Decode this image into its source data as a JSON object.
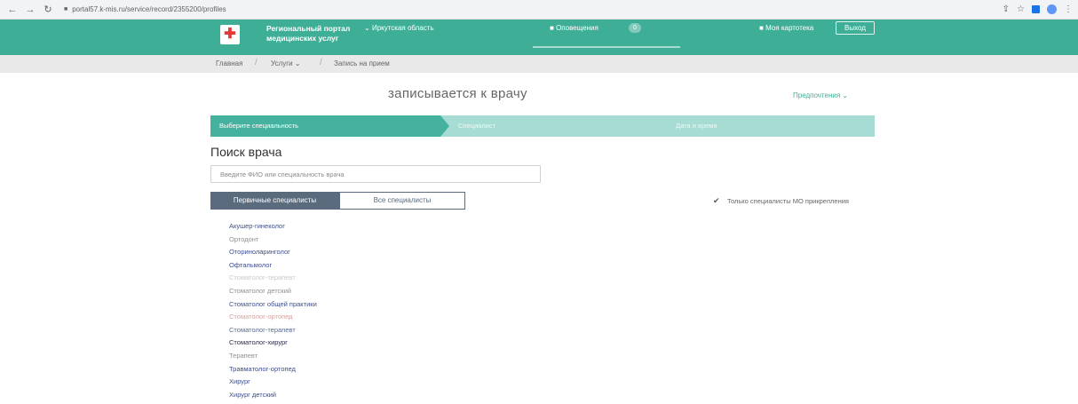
{
  "browser": {
    "url": "portal57.k-mis.ru/service/record/2355200/profiles",
    "colors": {
      "bar": "#f1f3f4"
    }
  },
  "header": {
    "portal_title_line1": "Региональный портал",
    "portal_title_line2": "медицинских услуг",
    "region": "Иркутская область",
    "notifications": "Оповещения",
    "notifications_count": "0",
    "cabinet": "Моя картотека",
    "logout": "Выход",
    "colors": {
      "header_bg": "#3fae97",
      "logo_cross": "#e53935"
    }
  },
  "breadcrumb": {
    "items": [
      "Главная",
      "Услуги",
      "Запись на прием"
    ]
  },
  "main": {
    "title": "записывается к врачу",
    "preferences": "Предпочтения",
    "steps": [
      "Выберите специальность",
      "Специалист",
      "Дата и время"
    ],
    "section_title": "Поиск врача",
    "search_placeholder": "Введите ФИО или специальность врача",
    "tabs": [
      "Первичные специалисты",
      "Все специалисты"
    ],
    "only_attached": "Только специалисты МО прикрепления",
    "colors": {
      "accent": "#45b2a0",
      "step_inactive": "#a6dcd3",
      "tab_active": "#5a6b7d"
    }
  },
  "specialists": [
    {
      "label": "Акушер-гинеколог",
      "color": "#3d4f8f"
    },
    {
      "label": "Ортодонт",
      "color": "#8f8f8f"
    },
    {
      "label": "Оториноларинголог",
      "color": "#3d4f8f"
    },
    {
      "label": "Офтальмолог",
      "color": "#3d4f8f"
    },
    {
      "label": "Стоматолог-терапевт",
      "color": "#c9c9c9"
    },
    {
      "label": "Стоматолог детский",
      "color": "#8f8f8f"
    },
    {
      "label": "Стоматолог общей практики",
      "color": "#3d4f8f"
    },
    {
      "label": "Стоматолог-ортопед",
      "color": "#d9a0a0"
    },
    {
      "label": "Стоматолог-терапевт",
      "color": "#5a6b8f"
    },
    {
      "label": "Стоматолог-хирург",
      "color": "#2a2a4a"
    },
    {
      "label": "Терапевт",
      "color": "#8f8f8f"
    },
    {
      "label": "Травматолог-ортопед",
      "color": "#3d4f8f"
    },
    {
      "label": "Хирург",
      "color": "#3d4f8f"
    },
    {
      "label": "Хирург детский",
      "color": "#3d4f8f"
    }
  ]
}
